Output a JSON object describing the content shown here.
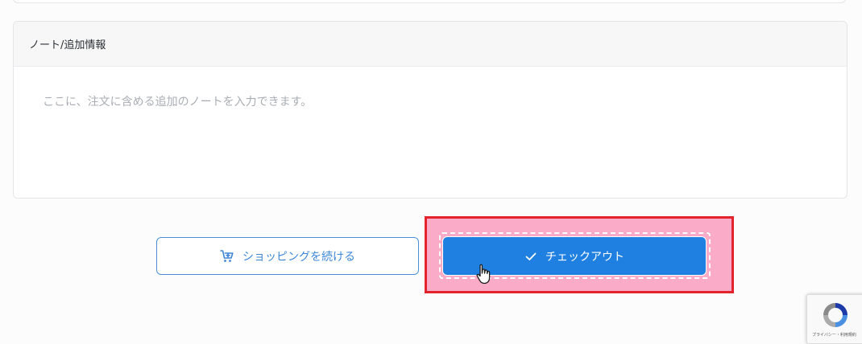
{
  "notes": {
    "title": "ノート/追加情報",
    "placeholder": "ここに、注文に含める追加のノートを入力できます。",
    "value": ""
  },
  "actions": {
    "continue_label": "ショッピングを続ける",
    "checkout_label": "チェックアウト"
  },
  "recaptcha": {
    "caption": "プライバシー・利用規約"
  },
  "colors": {
    "primary": "#1f80e2",
    "outline_button": "#3d86d6",
    "highlight_border": "#e3232b",
    "highlight_fill": "#f9abc8"
  },
  "icons": [
    "cart-plus-icon",
    "check-icon",
    "hand-pointer-cursor-icon",
    "recaptcha-logo-icon"
  ]
}
